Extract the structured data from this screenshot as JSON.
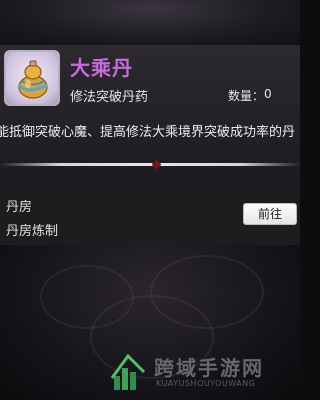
{
  "item": {
    "name": "大乘丹",
    "type": "修法突破丹药",
    "quantity_label": "数量：",
    "quantity_value": "0",
    "description": "能抵御突破心魔、提高修法大乘境界突破成功率的丹",
    "icon": "gourd-icon"
  },
  "source": {
    "title": "丹房",
    "subtitle": "丹房炼制",
    "goto_label": "前往"
  },
  "watermark": {
    "title": "跨域手游网",
    "subtitle": "KUAYUSHOUYOUWANG"
  },
  "colors": {
    "item_name": "#c96be0",
    "background": "#0d0c0e",
    "panel": "#1e1d21"
  }
}
